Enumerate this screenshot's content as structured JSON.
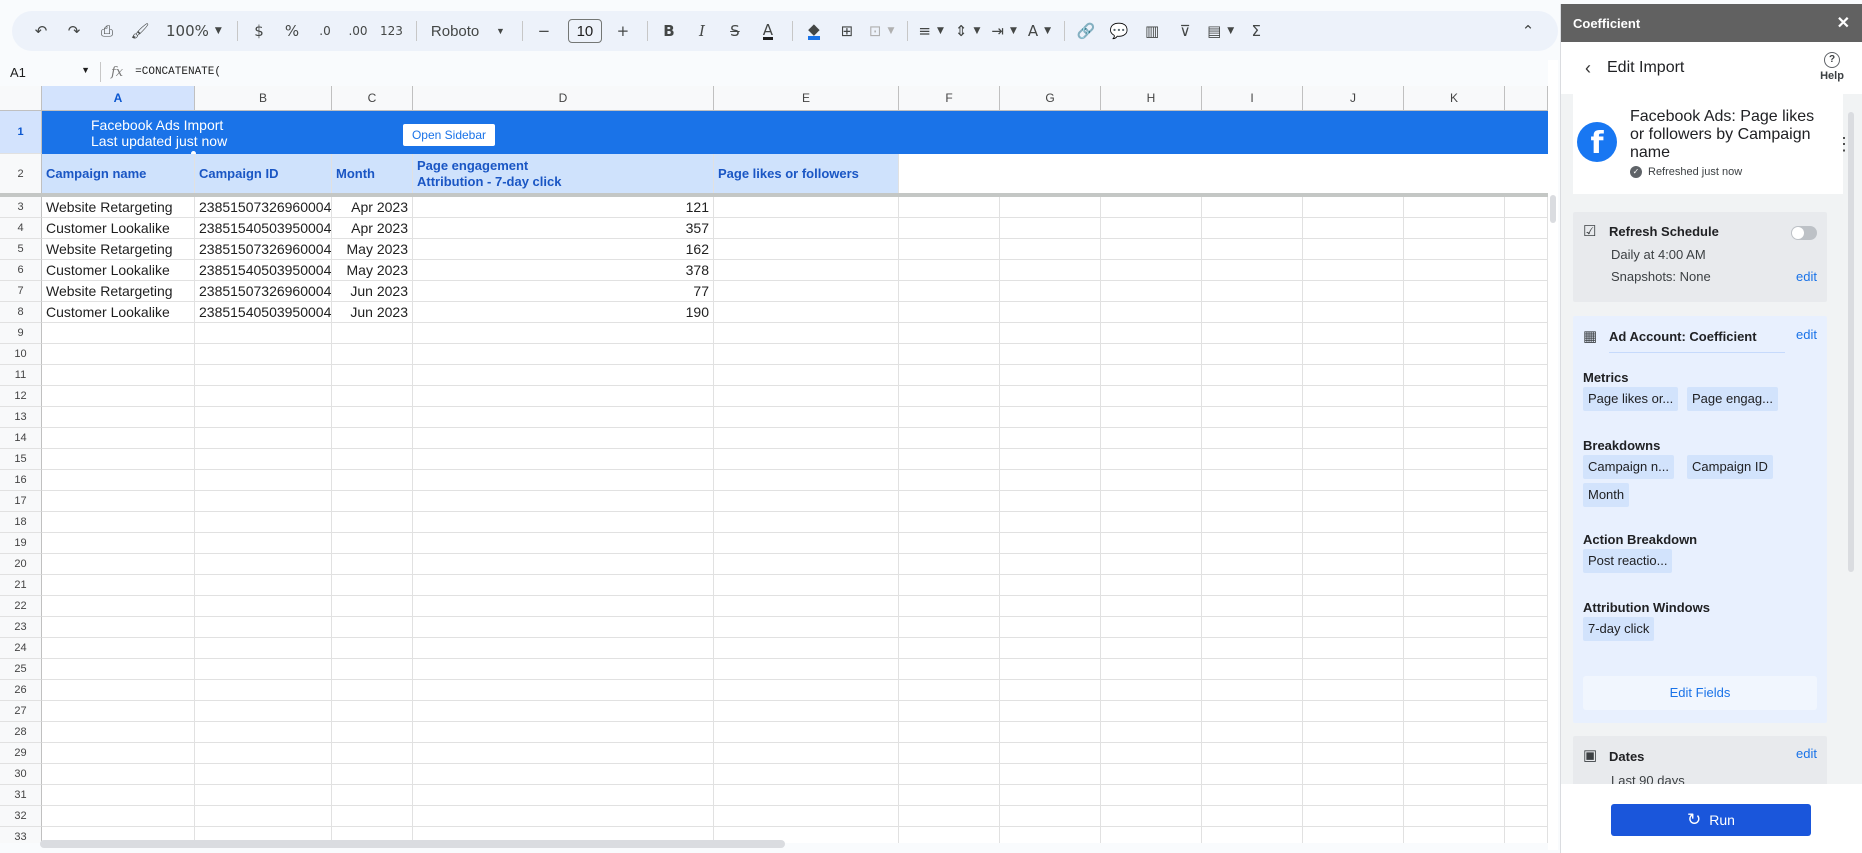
{
  "toolbar": {
    "zoom": "100%",
    "currency": "$",
    "percent": "%",
    "decrease_decimal": ".0",
    "increase_decimal": ".00",
    "number_format": "123",
    "font": "Roboto",
    "font_size": "10",
    "bold": "B",
    "italic": "I",
    "strike": "S",
    "text_color": "A",
    "sum": "Σ"
  },
  "formula_bar": {
    "cell_ref": "A1",
    "fx": "fx",
    "formula": "=CONCATENATE("
  },
  "grid": {
    "columns": [
      "A",
      "B",
      "C",
      "D",
      "E",
      "F",
      "G",
      "H",
      "I",
      "J",
      "K"
    ],
    "banner": {
      "title": "Facebook Ads Import",
      "subtitle": "Last updated just now",
      "button": "Open Sidebar"
    },
    "headers": [
      "Campaign name",
      "Campaign ID",
      "Month",
      "Page engagement",
      "Attribution - 7-day click",
      "Page likes or followers"
    ],
    "rows": [
      [
        "Website Retargeting",
        "23851507326960004",
        "Apr 2023",
        "121"
      ],
      [
        "Customer Lookalike",
        "23851540503950004",
        "Apr 2023",
        "357"
      ],
      [
        "Website Retargeting",
        "23851507326960004",
        "May 2023",
        "162"
      ],
      [
        "Customer Lookalike",
        "23851540503950004",
        "May 2023",
        "378"
      ],
      [
        "Website Retargeting",
        "23851507326960004",
        "Jun 2023",
        "77"
      ],
      [
        "Customer Lookalike",
        "23851540503950004",
        "Jun 2023",
        "190"
      ]
    ],
    "row_numbers": [
      "1",
      "2",
      "3",
      "4",
      "5",
      "6",
      "7",
      "8",
      "9",
      "10",
      "11",
      "12",
      "13",
      "14",
      "15",
      "16",
      "17",
      "18",
      "19",
      "20",
      "21",
      "22",
      "23",
      "24",
      "25",
      "26",
      "27",
      "28",
      "29",
      "30",
      "31",
      "32",
      "33"
    ]
  },
  "sidebar": {
    "app_name": "Coefficient",
    "close": "✕",
    "title": "Edit Import",
    "help": "Help",
    "import_name": "Facebook Ads: Page likes or followers by Campaign name",
    "refresh_status": "Refreshed just now",
    "schedule": {
      "title": "Refresh Schedule",
      "time": "Daily at 4:00 AM",
      "snapshots": "Snapshots: None",
      "edit": "edit"
    },
    "account": {
      "title": "Ad Account: Coefficient",
      "edit": "edit",
      "metrics_label": "Metrics",
      "metrics": [
        "Page likes or...",
        "Page engag..."
      ],
      "breakdowns_label": "Breakdowns",
      "breakdowns": [
        "Campaign n...",
        "Campaign ID",
        "Month"
      ],
      "action_label": "Action Breakdown",
      "actions": [
        "Post reactio..."
      ],
      "attribution_label": "Attribution Windows",
      "attributions": [
        "7-day click"
      ],
      "edit_fields": "Edit Fields"
    },
    "dates": {
      "title": "Dates",
      "edit": "edit",
      "value": "Last 90 days"
    },
    "run": "Run"
  },
  "colors": {
    "accent": "#1a73e8",
    "banner": "#1a73e8",
    "header_fill": "#cfe2fc",
    "run_button": "#1a56db",
    "facebook": "#1877f2"
  }
}
